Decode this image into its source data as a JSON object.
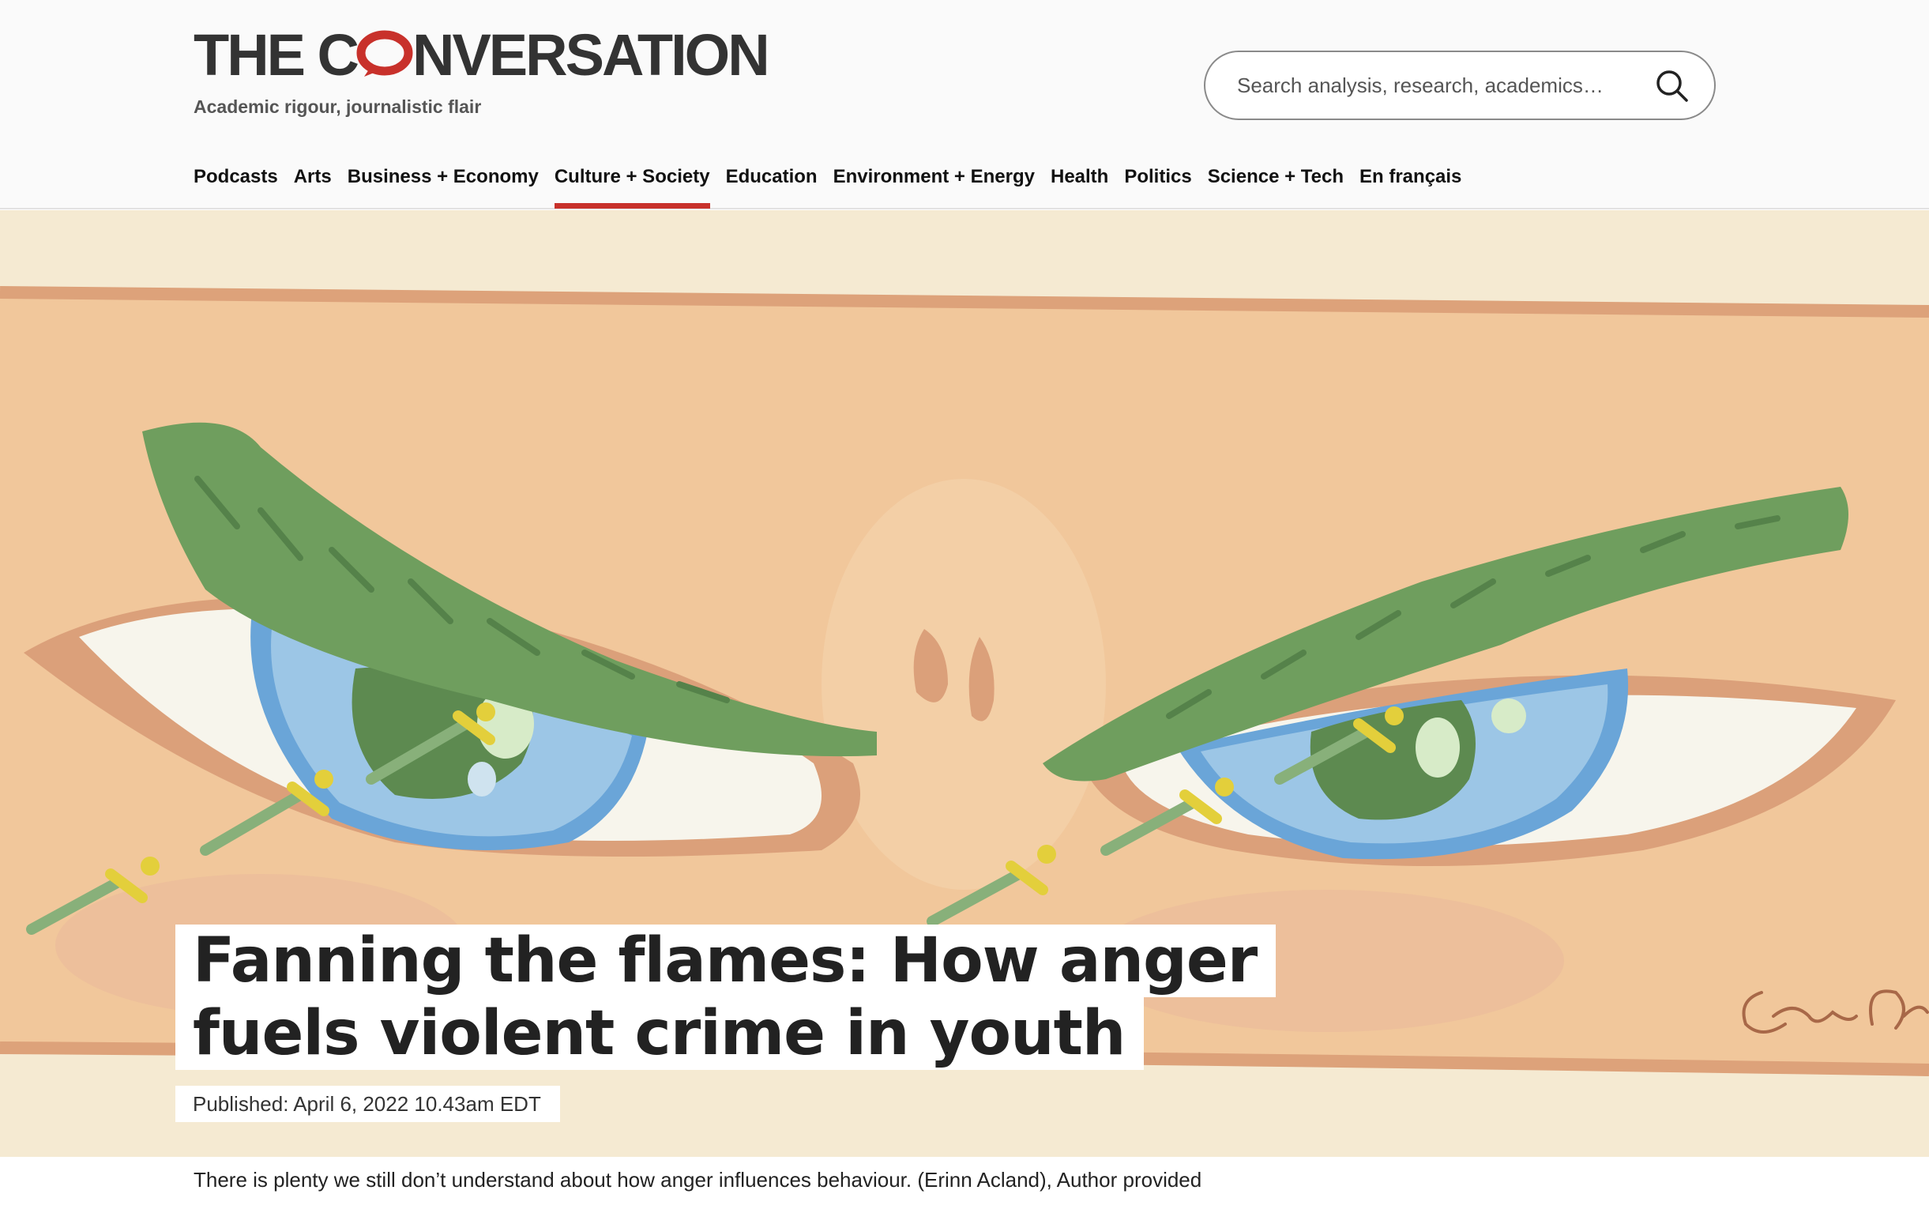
{
  "site": {
    "logo_text_before": "THE C",
    "logo_text_after": "NVERSATION",
    "tagline": "Academic rigour, journalistic flair",
    "brand_red": "#c8312b"
  },
  "search": {
    "placeholder": "Search analysis, research, academics…",
    "icon": "search-icon"
  },
  "nav": {
    "items": [
      {
        "label": "Podcasts"
      },
      {
        "label": "Arts"
      },
      {
        "label": "Business + Economy"
      },
      {
        "label": "Culture + Society",
        "active": true
      },
      {
        "label": "Education"
      },
      {
        "label": "Environment + Energy"
      },
      {
        "label": "Health"
      },
      {
        "label": "Politics"
      },
      {
        "label": "Science + Tech"
      },
      {
        "label": "En français"
      }
    ]
  },
  "article": {
    "headline_line1": "Fanning the flames: How anger",
    "headline_line2": "fuels violent crime in youth",
    "published": "Published: April 6, 2022 10.43am EDT",
    "caption": "There is plenty we still don’t understand about how anger influences behaviour. (Erinn Acland), Author provided",
    "signature": "Erinn Acland"
  }
}
